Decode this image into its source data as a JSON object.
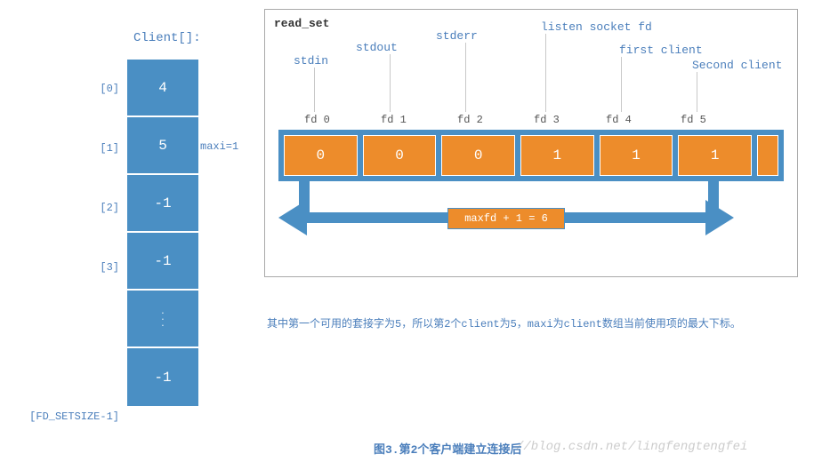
{
  "client_header": "Client[]:",
  "client_cells": [
    "4",
    "5",
    "-1",
    "-1",
    "-1"
  ],
  "client_indices": [
    "[0]",
    "[1]",
    "[2]",
    "[3]",
    "[FD_SETSIZE-1]"
  ],
  "maxi_label": "maxi=1",
  "readset": {
    "title": "read_set",
    "callouts": {
      "stdin": "stdin",
      "stdout": "stdout",
      "stderr": "stderr",
      "listen": "listen socket fd",
      "first": "first client",
      "second": "Second client"
    },
    "fd_labels": [
      "fd 0",
      "fd 1",
      "fd 2",
      "fd 3",
      "fd 4",
      "fd 5"
    ],
    "fd_values": [
      "0",
      "0",
      "0",
      "1",
      "1",
      "1"
    ],
    "maxfd_text": "maxfd + 1 = 6"
  },
  "explain_text": "其中第一个可用的套接字为5，所以第2个client为5，maxi为client数组当前使用项的最大下标。",
  "caption": "图3.第2个客户端建立连接后",
  "watermark": "//blog.csdn.net/lingfengtengfei",
  "chart_data": {
    "type": "table",
    "client_array": {
      "indices": [
        0,
        1,
        2,
        3,
        "FD_SETSIZE-1"
      ],
      "values": [
        4,
        5,
        -1,
        -1,
        -1
      ],
      "maxi": 1
    },
    "read_set": {
      "fd": [
        0,
        1,
        2,
        3,
        4,
        5
      ],
      "roles": [
        "stdin",
        "stdout",
        "stderr",
        "listen socket fd",
        "first client",
        "Second client"
      ],
      "bits": [
        0,
        0,
        0,
        1,
        1,
        1
      ]
    },
    "maxfd_plus_1": 6
  }
}
